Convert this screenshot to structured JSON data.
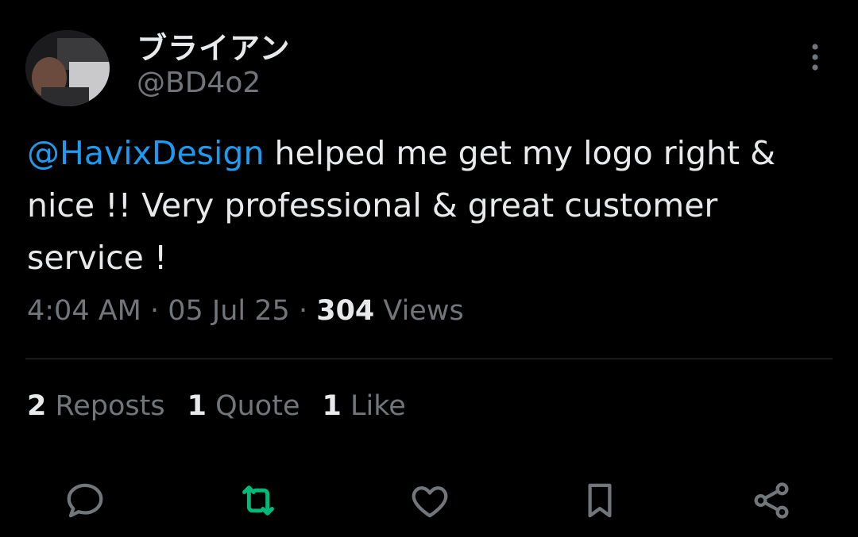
{
  "author": {
    "display_name": "ブライアン",
    "handle": "@BD4o2"
  },
  "tweet": {
    "mention": "@HavixDesign",
    "text": " helped me get my logo right & nice !! Very professional & great customer service !"
  },
  "meta": {
    "time": "4:04 AM",
    "sep1": " · ",
    "date": "05 Jul 25",
    "sep2": " · ",
    "views_count": "304",
    "views_label": " Views"
  },
  "stats": {
    "reposts_count": "2",
    "reposts_label": " Reposts",
    "quotes_count": "1",
    "quotes_label": " Quote",
    "likes_count": "1",
    "likes_label": " Like"
  },
  "actions": [
    {
      "icon": "reply-icon"
    },
    {
      "icon": "repost-icon",
      "color": "#00ba7c"
    },
    {
      "icon": "like-icon"
    },
    {
      "icon": "bookmark-icon"
    },
    {
      "icon": "share-icon"
    }
  ],
  "colors": {
    "background": "#000000",
    "text": "#e7e9ea",
    "muted": "#71767b",
    "link": "#1d9bf0",
    "repost_active": "#00ba7c"
  }
}
